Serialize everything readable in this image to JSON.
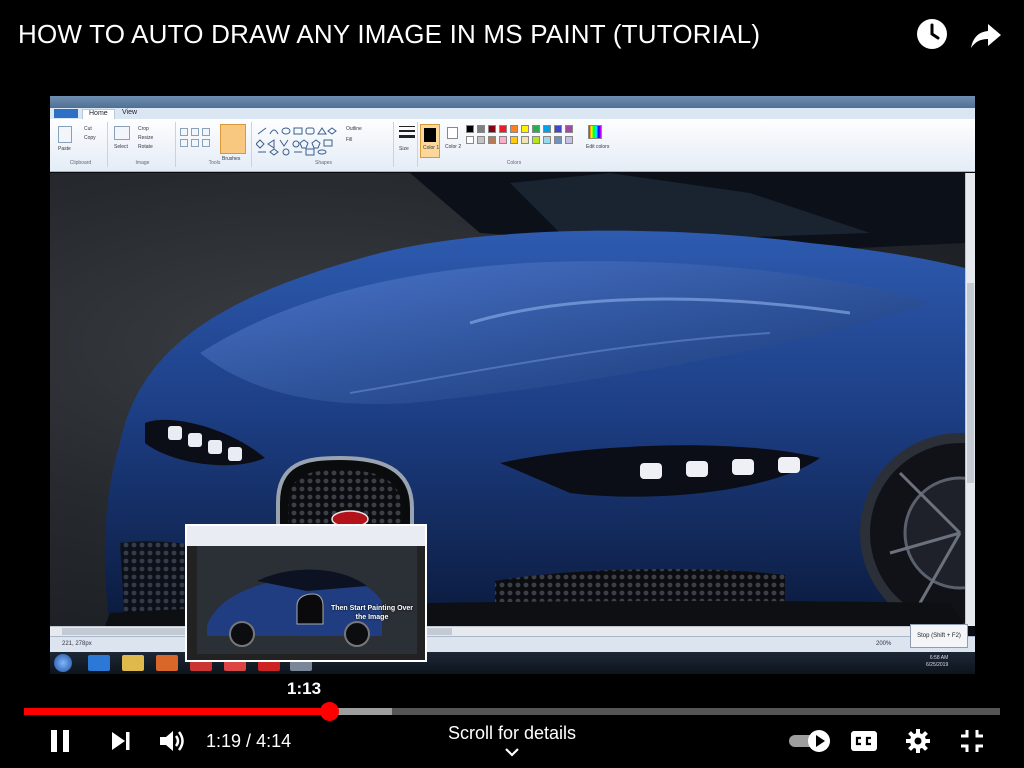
{
  "header": {
    "title": "HOW TO AUTO DRAW ANY IMAGE IN MS PAINT (TUTORIAL)",
    "icons": [
      "watch-later-icon",
      "share-icon"
    ]
  },
  "paint": {
    "tabs": [
      "Home",
      "View"
    ],
    "groups": [
      "Clipboard",
      "Image",
      "Tools",
      "Shapes",
      "Colors"
    ],
    "clipboard": {
      "paste": "Paste",
      "cut": "Cut",
      "copy": "Copy"
    },
    "image": {
      "select": "Select",
      "crop": "Crop",
      "resize": "Resize",
      "rotate": "Rotate"
    },
    "brushes": "Brushes",
    "shapes": {
      "outline": "Outline",
      "fill": "Fill"
    },
    "size": "Size",
    "color1": "Color 1",
    "color2": "Color 2",
    "edit_colors": "Edit colors",
    "palette": [
      "#000000",
      "#7f7f7f",
      "#880015",
      "#ed1c24",
      "#ff7f27",
      "#fff200",
      "#22b14c",
      "#00a2e8",
      "#3f48cc",
      "#a349a4",
      "#ffffff",
      "#c3c3c3",
      "#b97a57",
      "#ffaec9",
      "#ffc90e",
      "#efe4b0",
      "#b5e61d",
      "#99d9ea",
      "#7092be",
      "#c8bfe7"
    ],
    "status_coords": "221, 278px",
    "status_zoom": "200%",
    "stop_button": "Stop (Shift + F2)",
    "clock_time": "6:58 AM",
    "clock_date": "6/25/2019"
  },
  "preview": {
    "time": "1:13",
    "caption": "Then Start Painting Over the Image"
  },
  "player": {
    "current_time": "1:19",
    "separator": " / ",
    "duration": "4:14",
    "played_fraction": 0.313,
    "buffered_fraction": 0.377,
    "scroll_hint": "Scroll for details",
    "accent_color": "#ff0000"
  }
}
